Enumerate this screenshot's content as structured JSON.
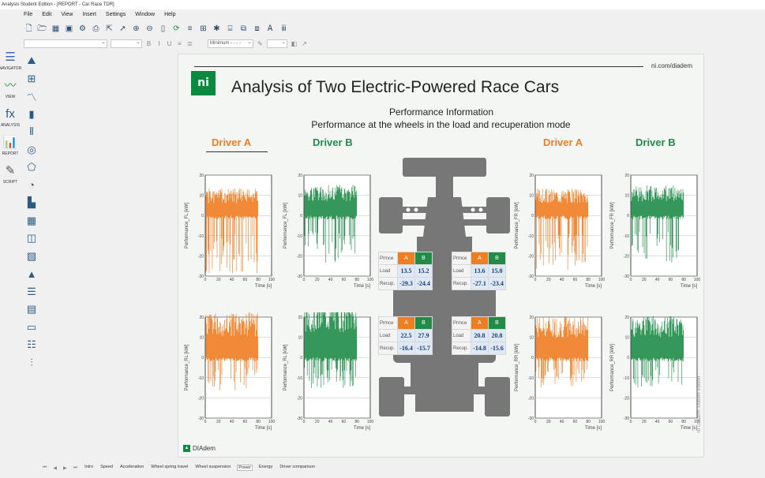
{
  "window": {
    "title": "Analysis Student Edition - [REPORT - Car Race TDR]"
  },
  "menu": [
    "File",
    "Edit",
    "View",
    "Insert",
    "Settings",
    "Window",
    "Help"
  ],
  "toolbar2": {
    "combo_value": "Minimum - - - -"
  },
  "panels": [
    {
      "icon": "☰",
      "label": "NAVIGATOR",
      "color": "#3a6aa5"
    },
    {
      "icon": "〰",
      "label": "VIEW",
      "color": "#2e8b3d"
    },
    {
      "icon": "fx",
      "label": "ANALYSIS",
      "color": "#2d5a85"
    },
    {
      "icon": "📊",
      "label": "REPORT",
      "color": "#c0392b"
    },
    {
      "icon": "✎",
      "label": "SCRIPT",
      "color": "#555"
    }
  ],
  "report_tools": [
    "axis-system-icon",
    "table-icon",
    "line-chart-icon",
    "bar-chart-icon",
    "polar-icon",
    "gauge-icon",
    "pentagon-icon",
    "clock-icon",
    "3d-bar-icon",
    "3d-grid-icon",
    "3d-surface-icon",
    "contour-icon",
    "image-icon",
    "text-icon",
    "document-icon",
    "frame-icon",
    "list-icon",
    "variable-icon"
  ],
  "sheet": {
    "url": "ni.com/diadem",
    "logo": "ni",
    "title": "Analysis of Two Electric-Powered Race Cars",
    "subtitle1": "Performance Information",
    "subtitle2": "Performance at the wheels in the load and recuperation mode",
    "driver_a": "Driver A",
    "driver_b": "Driver B",
    "footer": "DIAdem",
    "edition": "NI DIAdem Student Edition"
  },
  "colors": {
    "driver_a": "#ef7d22",
    "driver_b": "#1f8c48",
    "driver_b_dark": "#133d22",
    "ni_green": "#0b8a3f"
  },
  "tables": [
    {
      "head": "Prmce",
      "a": "A",
      "b": "B",
      "rows": [
        {
          "label": "Load",
          "a": "13.5",
          "b": "15.2"
        },
        {
          "label": "Recup.",
          "a": "-29.3",
          "b": "-24.4"
        }
      ]
    },
    {
      "head": "Prmce",
      "a": "A",
      "b": "B",
      "rows": [
        {
          "label": "Load",
          "a": "13.6",
          "b": "15.0"
        },
        {
          "label": "Recup.",
          "a": "-27.1",
          "b": "-23.4"
        }
      ]
    },
    {
      "head": "Prmce",
      "a": "A",
      "b": "B",
      "rows": [
        {
          "label": "Load",
          "a": "22.5",
          "b": "27.9"
        },
        {
          "label": "Recup.",
          "a": "-16.4",
          "b": "-15.7"
        }
      ]
    },
    {
      "head": "Prmce",
      "a": "A",
      "b": "B",
      "rows": [
        {
          "label": "Load",
          "a": "20.8",
          "b": "20.8"
        },
        {
          "label": "Recup.",
          "a": "-14.8",
          "b": "-15.6"
        }
      ]
    }
  ],
  "chart_data": [
    {
      "type": "line",
      "xlabel": "Time [s]",
      "ylabel": "Performance_FL [kW]",
      "xlim": [
        0,
        100
      ],
      "ylim": [
        -30,
        20
      ],
      "xticks": [
        "0",
        "20",
        "40",
        "60",
        "80",
        "100"
      ],
      "yticks": [
        "20",
        "10",
        "0",
        "-10",
        "-20",
        "-30"
      ],
      "series": [
        {
          "color": "driver_a",
          "max": 13.5,
          "min": -29.3,
          "seed": 1
        }
      ]
    },
    {
      "type": "line",
      "xlabel": "Time [s]",
      "ylabel": "Performance_FL [kW]",
      "xlim": [
        0,
        100
      ],
      "ylim": [
        -30,
        20
      ],
      "xticks": [
        "0",
        "20",
        "40",
        "60",
        "80",
        "100"
      ],
      "yticks": [
        "20",
        "10",
        "0",
        "-10",
        "-20",
        "-30"
      ],
      "series": [
        {
          "color": "driver_b",
          "max": 15.2,
          "min": -24.4,
          "seed": 2
        }
      ]
    },
    {
      "type": "line",
      "xlabel": "Time [s]",
      "ylabel": "Performance_FR [kW]",
      "xlim": [
        0,
        100
      ],
      "ylim": [
        -30,
        20
      ],
      "xticks": [
        "0",
        "20",
        "40",
        "60",
        "80",
        "100"
      ],
      "yticks": [
        "20",
        "10",
        "0",
        "-10",
        "-20",
        "-30"
      ],
      "series": [
        {
          "color": "driver_a",
          "max": 13.6,
          "min": -27.1,
          "seed": 3
        }
      ]
    },
    {
      "type": "line",
      "xlabel": "Time [s]",
      "ylabel": "Performance_FR [kW]",
      "xlim": [
        0,
        100
      ],
      "ylim": [
        -30,
        20
      ],
      "xticks": [
        "0",
        "20",
        "40",
        "60",
        "80",
        "100"
      ],
      "yticks": [
        "20",
        "10",
        "0",
        "-10",
        "-20",
        "-30"
      ],
      "series": [
        {
          "color": "driver_b",
          "max": 15.0,
          "min": -23.4,
          "seed": 4
        }
      ]
    },
    {
      "type": "line",
      "xlabel": "Time [s]",
      "ylabel": "Performance_RL [kW]",
      "xlim": [
        0,
        100
      ],
      "ylim": [
        -30,
        20
      ],
      "xticks": [
        "0",
        "20",
        "40",
        "60",
        "80",
        "100"
      ],
      "yticks": [
        "20",
        "10",
        "0",
        "-10",
        "-20",
        "-30"
      ],
      "series": [
        {
          "color": "driver_a",
          "max": 22.5,
          "min": -16.4,
          "seed": 5
        }
      ]
    },
    {
      "type": "line",
      "xlabel": "Time [s]",
      "ylabel": "Performance_RL [kW]",
      "xlim": [
        0,
        100
      ],
      "ylim": [
        -30,
        20
      ],
      "xticks": [
        "0",
        "20",
        "40",
        "60",
        "80",
        "100"
      ],
      "yticks": [
        "20",
        "10",
        "0",
        "-10",
        "-20",
        "-30"
      ],
      "series": [
        {
          "color": "driver_b",
          "max": 27.9,
          "min": -15.7,
          "seed": 6
        }
      ]
    },
    {
      "type": "line",
      "xlabel": "Time [s]",
      "ylabel": "Performance_RR [kW]",
      "xlim": [
        0,
        100
      ],
      "ylim": [
        -30,
        20
      ],
      "xticks": [
        "0",
        "20",
        "40",
        "60",
        "80",
        "100"
      ],
      "yticks": [
        "20",
        "10",
        "0",
        "-10",
        "-20",
        "-30"
      ],
      "series": [
        {
          "color": "driver_a",
          "max": 20.8,
          "min": -14.8,
          "seed": 7
        }
      ]
    },
    {
      "type": "line",
      "xlabel": "Time [s]",
      "ylabel": "Performance_RR [kW]",
      "xlim": [
        0,
        100
      ],
      "ylim": [
        -30,
        20
      ],
      "xticks": [
        "0",
        "20",
        "40",
        "60",
        "80",
        "100"
      ],
      "yticks": [
        "20",
        "10",
        "0",
        "-10",
        "-20",
        "-30"
      ],
      "series": [
        {
          "color": "driver_b",
          "max": 20.8,
          "min": -15.6,
          "seed": 8
        }
      ]
    }
  ],
  "sheet_tabs": [
    "Intro",
    "Speed",
    "Acceleration",
    "Wheel spring travel",
    "Wheel suspension",
    "Power",
    "Energy",
    "Driver comparison"
  ],
  "active_tab": "Power"
}
